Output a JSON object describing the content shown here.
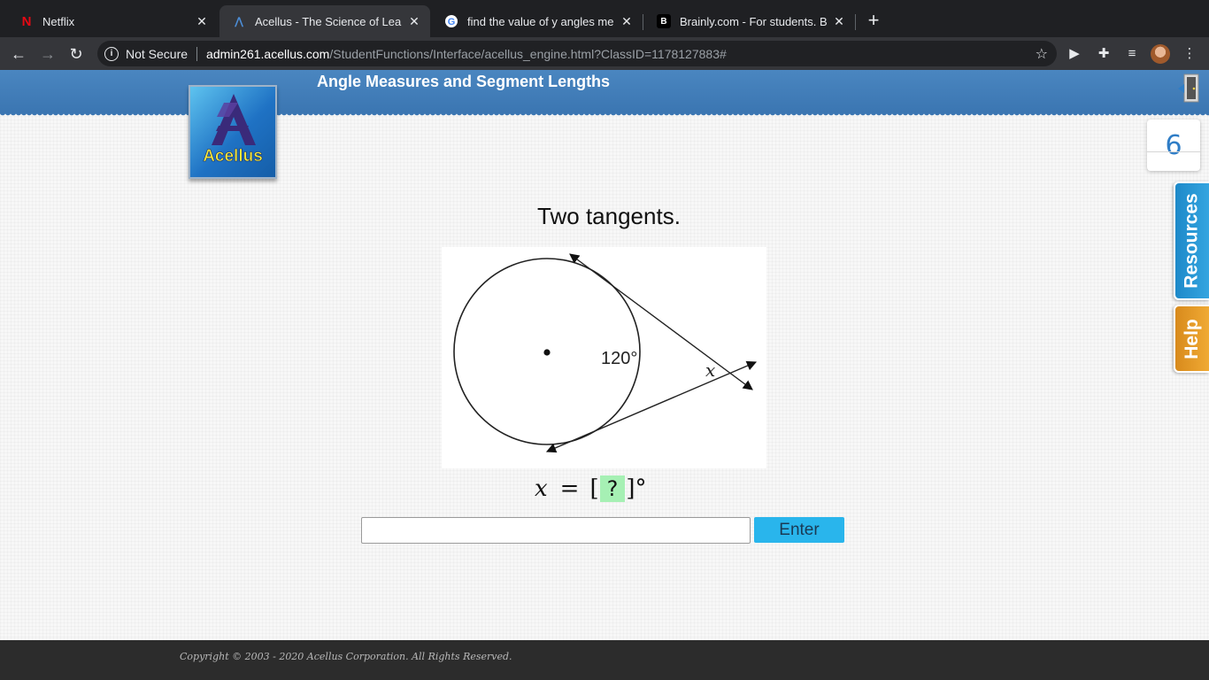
{
  "browser": {
    "tabs": [
      {
        "title": "Netflix",
        "favicon": "netflix-icon",
        "active": false
      },
      {
        "title": "Acellus - The Science of Learni",
        "favicon": "acellus-icon",
        "active": true
      },
      {
        "title": "find the value of y angles meas",
        "favicon": "google-icon",
        "active": false
      },
      {
        "title": "Brainly.com - For students. By",
        "favicon": "brainly-icon",
        "active": false
      }
    ],
    "omnibox": {
      "security": "Not Secure",
      "host": "admin261.acellus.com",
      "path": "/StudentFunctions/Interface/acellus_engine.html?ClassID=1178127883#"
    }
  },
  "header": {
    "lesson_title": "Angle Measures and Segment Lengths",
    "logo_text": "Acellus"
  },
  "step": {
    "number": "6"
  },
  "side_tabs": {
    "resources": "Resources",
    "help": "Help"
  },
  "question": {
    "title": "Two tangents.",
    "arc_label": "120°",
    "angle_label": "x",
    "equation": {
      "variable": "x",
      "equals": "=",
      "open": "[",
      "placeholder": "?",
      "close": "]",
      "unit": "°"
    }
  },
  "answer": {
    "value": "",
    "placeholder": "",
    "enter_label": "Enter"
  },
  "footer": {
    "copyright": "Copyright © 2003 - 2020 Acellus Corporation.  All Rights Reserved."
  },
  "colors": {
    "header_blue": "#3b76b2",
    "enter_button": "#29b5ec",
    "resources_tab": "#2a9bd8",
    "help_tab": "#e89b2a",
    "answer_box": "#a6f0b4"
  }
}
